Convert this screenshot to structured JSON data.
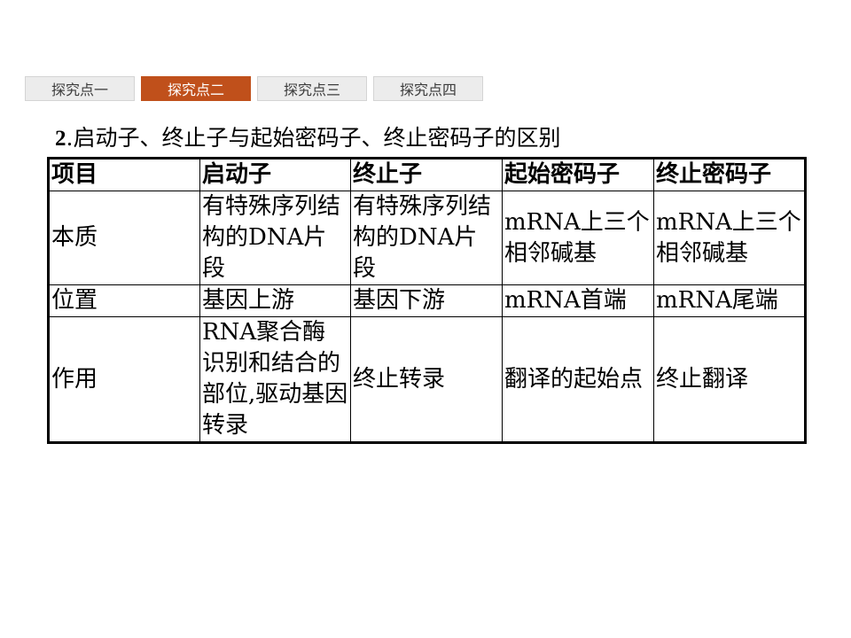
{
  "nav": {
    "tabs": [
      {
        "label": "探究点一",
        "active": false
      },
      {
        "label": "探究点二",
        "active": true
      },
      {
        "label": "探究点三",
        "active": false
      },
      {
        "label": "探究点四",
        "active": false
      }
    ],
    "colors": {
      "active_bg": "#c0501b",
      "inactive_bg": "#ececec"
    }
  },
  "heading": {
    "number": "2",
    "text": ".启动子、终止子与起始密码子、终止密码子的区别"
  },
  "table": {
    "headers": [
      "项目",
      "启动子",
      "终止子",
      "起始密码子",
      "终止密码子"
    ],
    "rows": [
      [
        "本质",
        "有特殊序列结构的DNA片段",
        "有特殊序列结构的DNA片段",
        "mRNA上三个相邻碱基",
        "mRNA上三个相邻碱基"
      ],
      [
        "位置",
        "基因上游",
        "基因下游",
        "mRNA首端",
        "mRNA尾端"
      ],
      [
        "作用",
        "RNA聚合酶识别和结合的部位,驱动基因转录",
        "终止转录",
        "翻译的起始点",
        "终止翻译"
      ]
    ]
  }
}
